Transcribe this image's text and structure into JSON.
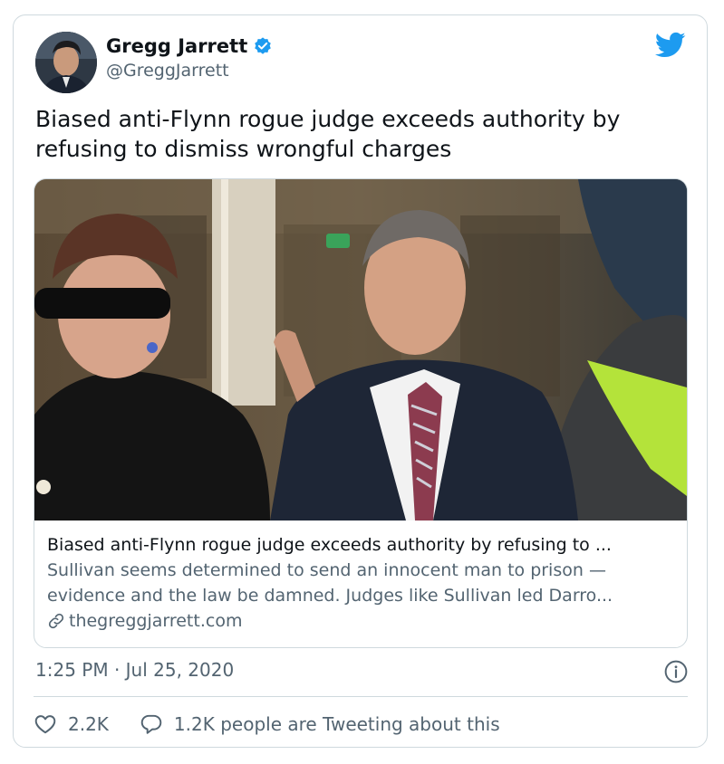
{
  "author": {
    "name": "Gregg Jarrett",
    "handle": "@GreggJarrett",
    "verified_color": "#1d9bf0",
    "icons": {
      "verified": "verified-badge-icon",
      "brand": "twitter-bird-icon"
    }
  },
  "tweet": {
    "text": "Biased anti-Flynn rogue judge exceeds authority by refusing to dismiss wrongful charges"
  },
  "link_card": {
    "title": "Biased anti-Flynn rogue judge exceeds authority by refusing to ...",
    "description_line1": "Sullivan seems determined to send an innocent man to prison —",
    "description_line2": "evidence and the law be damned. Judges like Sullivan led Darro...",
    "domain": "thegreggjarrett.com",
    "domain_icon": "link-chain-icon"
  },
  "meta": {
    "timestamp": "1:25 PM · Jul 25, 2020",
    "info_icon": "info-icon"
  },
  "actions": {
    "likes": "2.2K",
    "replies_text": "1.2K people are Tweeting about this",
    "like_icon": "heart-icon",
    "reply_icon": "speech-bubble-icon"
  },
  "colors": {
    "brand_blue": "#1d9bf0",
    "text_primary": "#0f1419",
    "text_secondary": "#536471",
    "border": "#cfd9de"
  }
}
